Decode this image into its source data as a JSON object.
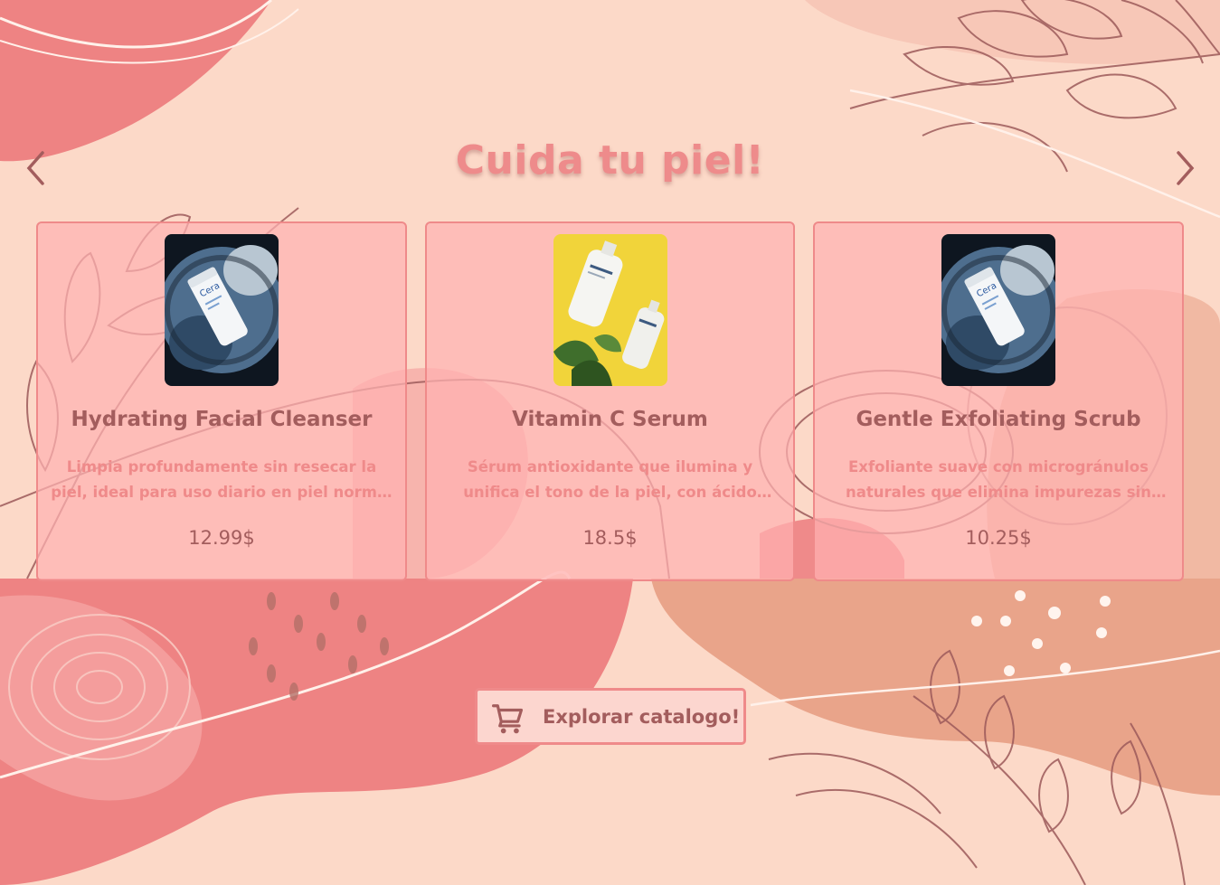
{
  "page": {
    "title": "Cuida tu piel!"
  },
  "carousel": {
    "prev_icon": "chevron-left-icon",
    "next_icon": "chevron-right-icon"
  },
  "products": [
    {
      "name": "Hydrating Facial Cleanser",
      "description": "Limpia profundamente sin resecar la piel, ideal para uso diario en piel normal a seca.",
      "price": "12.99$",
      "image": "cerave-tube-photo"
    },
    {
      "name": "Vitamin C Serum",
      "description": "Sérum antioxidante que ilumina y unifica el tono de la piel, con ácido hialurónico.",
      "price": "18.5$",
      "image": "sesderma-bottles-photo"
    },
    {
      "name": "Gentle Exfoliating Scrub",
      "description": "Exfoliante suave con microgránulos naturales que elimina impurezas sin irritar.",
      "price": "10.25$",
      "image": "cerave-tube-photo"
    }
  ],
  "cta": {
    "label": "Explorar catalogo!",
    "icon": "shopping-cart-icon"
  },
  "colors": {
    "background": "#fcd9c8",
    "accent": "#ef8a8a",
    "text_dark": "#a35d5d",
    "card_fill": "#ffb2b2"
  }
}
